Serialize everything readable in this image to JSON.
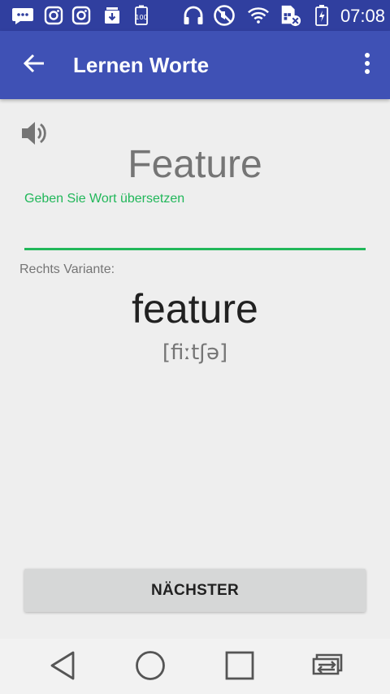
{
  "status_bar": {
    "time": "07:08",
    "icons": [
      "notification-chat-icon",
      "instagram-icon",
      "instagram-icon",
      "download-icon",
      "battery-saver-100-icon",
      "headphones-icon",
      "do-not-disturb-icon",
      "wifi-icon",
      "no-sim-icon",
      "battery-charging-icon"
    ]
  },
  "app_bar": {
    "title": "Lernen Worte",
    "back_icon": "arrow-back-icon",
    "menu_icon": "more-vert-icon"
  },
  "card": {
    "speaker_icon": "volume-up-icon",
    "word": "Feature",
    "input": {
      "label": "Geben Sie Wort übersetzen",
      "value": ""
    },
    "variant_label": "Rechts Variante:",
    "answer": "feature",
    "transcription": "[fiːtʃə]"
  },
  "next_button": {
    "label": "NÄCHSTER"
  },
  "nav_bar": {
    "icons": [
      "back-triangle-icon",
      "home-circle-icon",
      "recents-square-icon",
      "switch-apps-icon"
    ]
  },
  "colors": {
    "status_bar": "#303F9F",
    "app_bar": "#3F51B5",
    "accent": "#21B75A",
    "background": "#EEEEEE"
  }
}
